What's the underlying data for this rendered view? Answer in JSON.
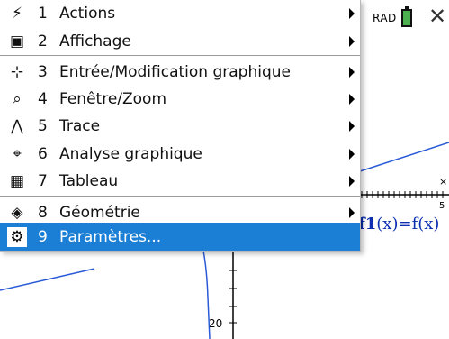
{
  "status": {
    "angle_mode": "RAD",
    "battery_color": "#4caf50"
  },
  "graph": {
    "x_tick_label": "5",
    "y_tick_label": "20",
    "axis_x_symbol": "×",
    "function_label": {
      "prefix": "f1",
      "arg": "(x)",
      "rhs": "=f(x)"
    },
    "curve_color": "#2a5bd7"
  },
  "menu": {
    "items": [
      {
        "number": "1",
        "label": "Actions",
        "icon": "lightning-icon",
        "submenu": true
      },
      {
        "number": "2",
        "label": "Affichage",
        "icon": "view-icon",
        "submenu": true
      },
      {
        "number": "3",
        "label": "Entrée/Modification graphique",
        "icon": "graph-entry-icon",
        "submenu": true
      },
      {
        "number": "4",
        "label": "Fenêtre/Zoom",
        "icon": "zoom-icon",
        "submenu": true
      },
      {
        "number": "5",
        "label": "Trace",
        "icon": "trace-icon",
        "submenu": true
      },
      {
        "number": "6",
        "label": "Analyse graphique",
        "icon": "analyze-icon",
        "submenu": true
      },
      {
        "number": "7",
        "label": "Tableau",
        "icon": "table-icon",
        "submenu": true
      },
      {
        "number": "8",
        "label": "Géométrie",
        "icon": "geometry-icon",
        "submenu": true
      },
      {
        "number": "9",
        "label": "Paramètres...",
        "icon": "gear-icon",
        "submenu": false,
        "selected": true
      }
    ],
    "selected_color": "#1c7fd6"
  }
}
